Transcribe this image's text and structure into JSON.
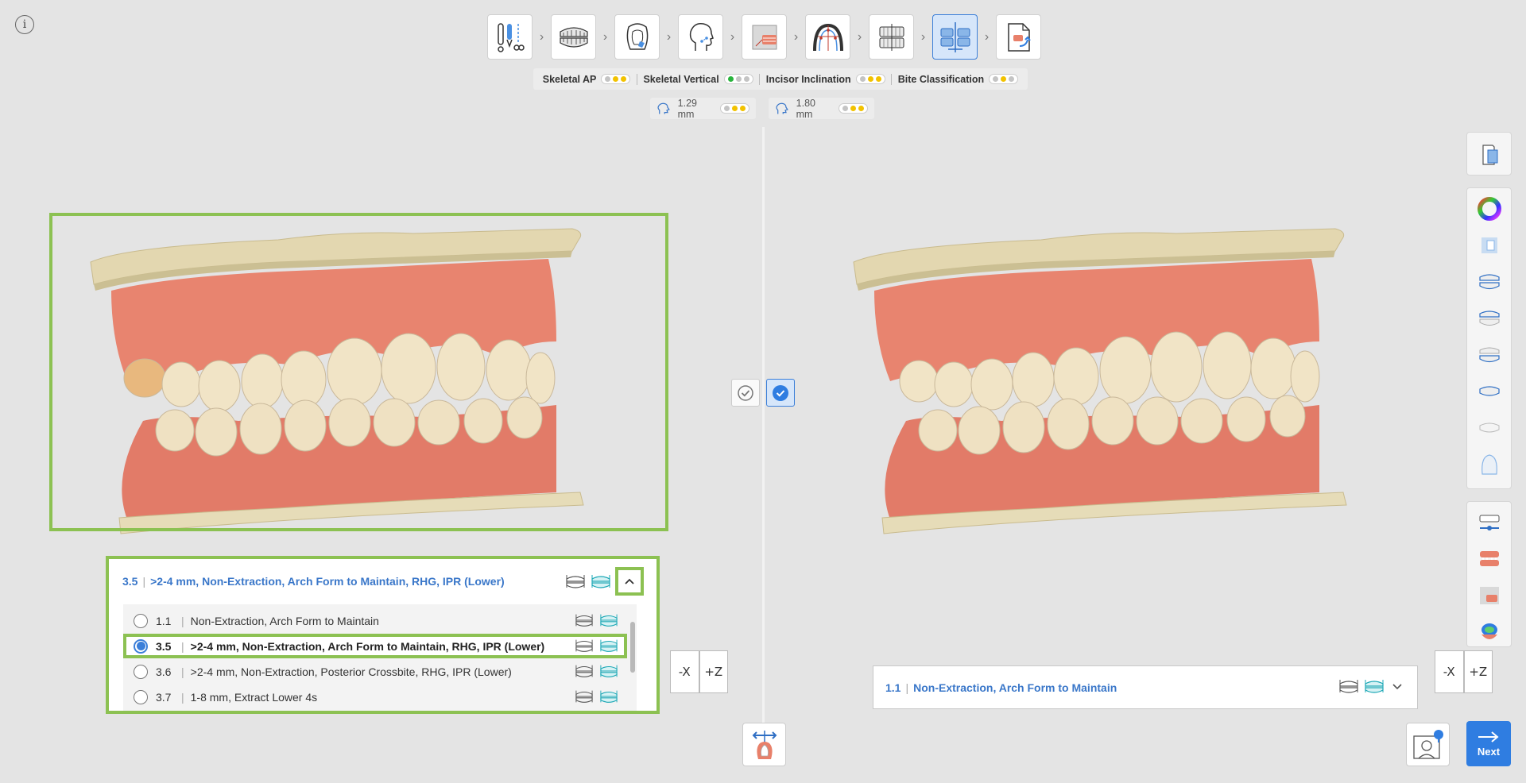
{
  "info": {
    "glyph": "i"
  },
  "workflow_steps": [
    {
      "name": "scan-tools-step",
      "active": false
    },
    {
      "name": "jaw-models-step",
      "active": false
    },
    {
      "name": "tooth-segmentation-step",
      "active": false
    },
    {
      "name": "cephalometric-step",
      "active": false
    },
    {
      "name": "xray-overlay-step",
      "active": false
    },
    {
      "name": "arch-analysis-step",
      "active": false
    },
    {
      "name": "occlusion-step",
      "active": false
    },
    {
      "name": "plan-compare-step",
      "active": true
    },
    {
      "name": "export-step",
      "active": false
    }
  ],
  "classification": {
    "items": [
      {
        "label": "Skeletal AP",
        "dots": [
          "grey",
          "yellow",
          "yellow"
        ]
      },
      {
        "label": "Skeletal Vertical",
        "dots": [
          "green",
          "grey",
          "grey"
        ]
      },
      {
        "label": "Incisor Inclination",
        "dots": [
          "grey",
          "yellow",
          "yellow"
        ]
      },
      {
        "label": "Bite Classification",
        "dots": [
          "grey",
          "yellow",
          "grey"
        ]
      }
    ]
  },
  "measurements": [
    {
      "value": "1.29 mm",
      "dots": [
        "grey",
        "yellow",
        "yellow"
      ]
    },
    {
      "value": "1.80 mm",
      "dots": [
        "grey",
        "yellow",
        "yellow"
      ]
    }
  ],
  "left_plan": {
    "selected_num": "3.5",
    "selected_label": ">2-4 mm, Non-Extraction, Arch Form to Maintain, RHG, IPR (Lower)",
    "options": [
      {
        "num": "1.1",
        "label": "Non-Extraction, Arch Form to Maintain",
        "selected": false
      },
      {
        "num": "3.5",
        "label": ">2-4 mm, Non-Extraction, Arch Form to Maintain, RHG, IPR (Lower)",
        "selected": true
      },
      {
        "num": "3.6",
        "label": ">2-4 mm, Non-Extraction, Posterior Crossbite, RHG, IPR (Lower)",
        "selected": false
      },
      {
        "num": "3.7",
        "label": "1-8 mm, Extract Lower 4s",
        "selected": false
      }
    ]
  },
  "right_plan": {
    "selected_num": "1.1",
    "selected_label": "Non-Extraction, Arch Form to Maintain"
  },
  "axis_cube": {
    "minus": "-X",
    "plus": "+Z"
  },
  "next_button": {
    "label": "Next"
  },
  "colors": {
    "accent": "#2f7de1",
    "highlight": "#8cc152",
    "gum": "#e8806a",
    "tooth": "#f2e9d4",
    "base": "#e6dcb8"
  }
}
